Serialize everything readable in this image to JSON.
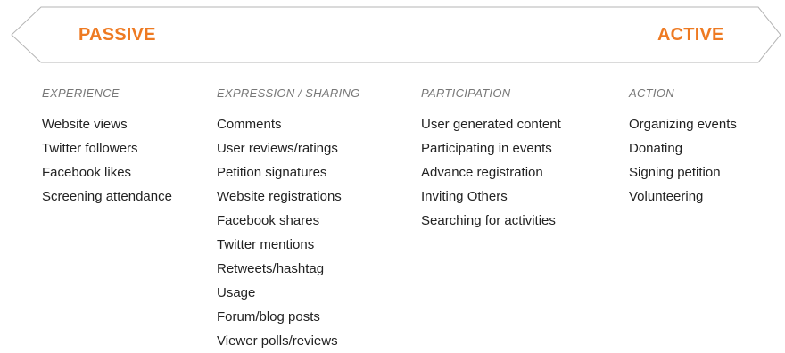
{
  "spectrum": {
    "left_label": "PASSIVE",
    "right_label": "ACTIVE"
  },
  "colors": {
    "accent": "#ee7a22",
    "heading": "#777777",
    "text": "#222222",
    "arrow_stroke": "#b5b5b5"
  },
  "columns": [
    {
      "heading": "EXPERIENCE",
      "items": [
        "Website views",
        "Twitter followers",
        "Facebook likes",
        "Screening attendance"
      ]
    },
    {
      "heading": "EXPRESSION / SHARING",
      "items": [
        "Comments",
        "User reviews/ratings",
        "Petition signatures",
        "Website registrations",
        "Facebook shares",
        "Twitter mentions",
        "Retweets/hashtag",
        "Usage",
        "Forum/blog posts",
        "Viewer polls/reviews"
      ]
    },
    {
      "heading": "PARTICIPATION",
      "items": [
        "User generated content",
        "Participating in events",
        "Advance registration",
        "Inviting Others",
        "Searching for activities"
      ]
    },
    {
      "heading": "ACTION",
      "items": [
        "Organizing events",
        "Donating",
        "Signing petition",
        "Volunteering"
      ]
    }
  ]
}
